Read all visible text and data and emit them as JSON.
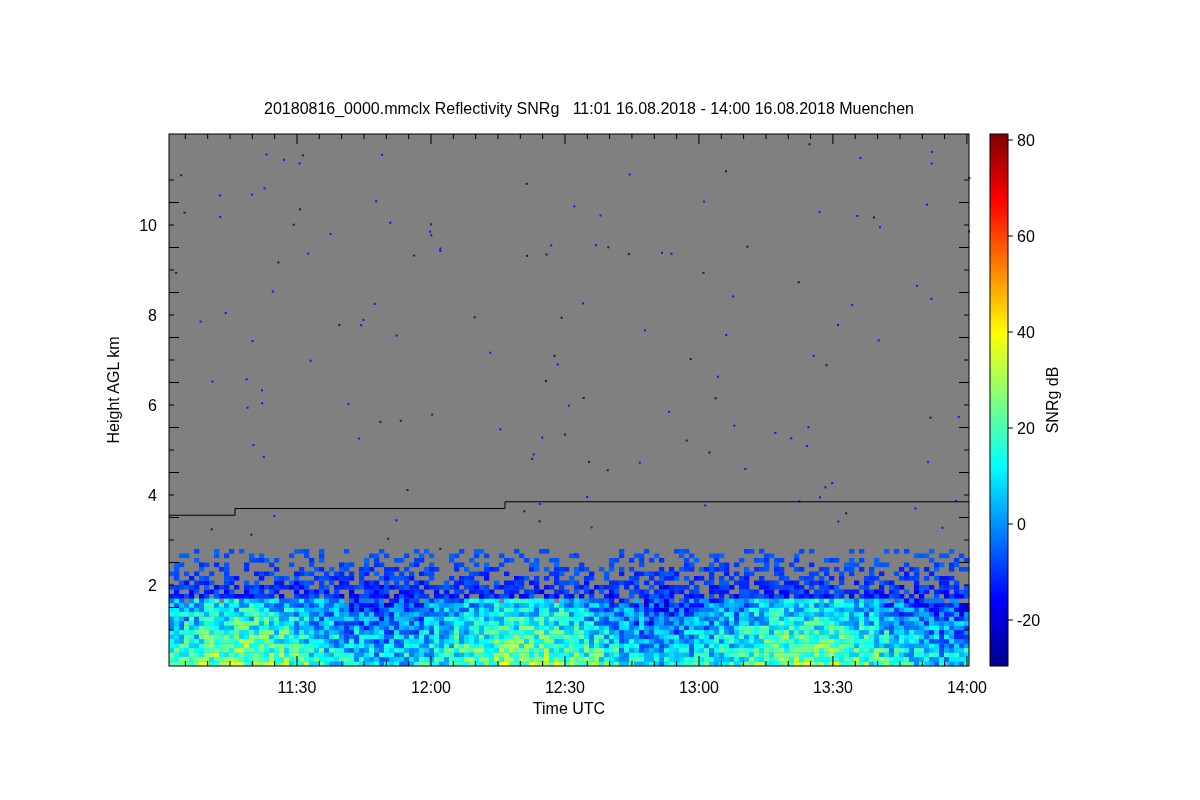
{
  "title": "20180816_0000.mmclx Reflectivity SNRg   11:01 16.08.2018 - 14:00 16.08.2018 Muenchen",
  "y_axis": {
    "label": "Height AGL km",
    "ticks": [
      "10",
      "8",
      "6",
      "4",
      "2"
    ]
  },
  "x_axis": {
    "label": "Time UTC",
    "ticks": [
      "11:30",
      "12:00",
      "12:30",
      "13:00",
      "13:30",
      "14:00"
    ]
  },
  "colorbar": {
    "label": "SNRg dB",
    "ticks": [
      "80",
      "60",
      "40",
      "20",
      "0",
      "-20"
    ]
  }
}
